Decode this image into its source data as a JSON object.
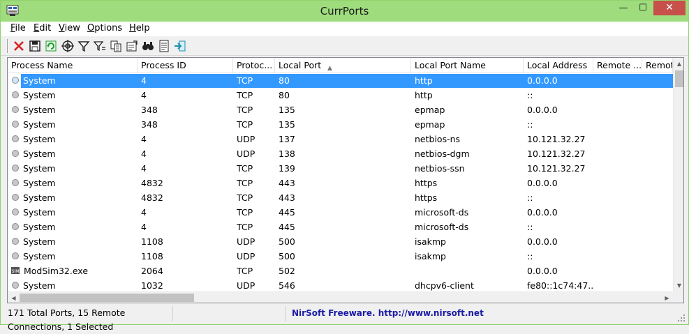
{
  "window": {
    "title": "CurrPorts",
    "minimize_glyph": "—",
    "maximize_glyph": "☐",
    "close_glyph": "✕"
  },
  "menu": [
    {
      "label": "File",
      "u": "F",
      "rest": "ile"
    },
    {
      "label": "Edit",
      "u": "E",
      "rest": "dit"
    },
    {
      "label": "View",
      "u": "V",
      "rest": "iew"
    },
    {
      "label": "Options",
      "u": "O",
      "rest": "ptions"
    },
    {
      "label": "Help",
      "u": "H",
      "rest": "elp"
    }
  ],
  "toolbar": [
    {
      "name": "close-connections-icon",
      "color": "#d42020"
    },
    {
      "name": "save-icon",
      "color": "#222222"
    },
    {
      "name": "refresh-icon",
      "color": "#1f9b2e"
    },
    {
      "name": "target-icon",
      "color": "#222222"
    },
    {
      "name": "filter-icon",
      "color": "#222222"
    },
    {
      "name": "filter-advanced-icon",
      "color": "#222222"
    },
    {
      "name": "copy-icon",
      "color": "#222222"
    },
    {
      "name": "properties-icon",
      "color": "#222222"
    },
    {
      "name": "find-icon",
      "color": "#222222"
    },
    {
      "name": "html-report-icon",
      "color": "#222222"
    },
    {
      "name": "exit-icon",
      "color": "#1b8fb0"
    }
  ],
  "columns": [
    "Process Name",
    "Process ID",
    "Protoc...",
    "Local Port",
    "Local Port Name",
    "Local Address",
    "Remote ...",
    "Remot"
  ],
  "sort_indicator": "▲",
  "rows": [
    {
      "process": "System",
      "pid": "4",
      "protocol": "TCP",
      "local_port": "80",
      "port_name": "http",
      "local_address": "0.0.0.0",
      "selected": true,
      "icon": "system"
    },
    {
      "process": "System",
      "pid": "4",
      "protocol": "TCP",
      "local_port": "80",
      "port_name": "http",
      "local_address": "::",
      "selected": false,
      "icon": "system"
    },
    {
      "process": "System",
      "pid": "348",
      "protocol": "TCP",
      "local_port": "135",
      "port_name": "epmap",
      "local_address": "0.0.0.0",
      "selected": false,
      "icon": "system"
    },
    {
      "process": "System",
      "pid": "348",
      "protocol": "TCP",
      "local_port": "135",
      "port_name": "epmap",
      "local_address": "::",
      "selected": false,
      "icon": "system"
    },
    {
      "process": "System",
      "pid": "4",
      "protocol": "UDP",
      "local_port": "137",
      "port_name": "netbios-ns",
      "local_address": "10.121.32.27",
      "selected": false,
      "icon": "system"
    },
    {
      "process": "System",
      "pid": "4",
      "protocol": "UDP",
      "local_port": "138",
      "port_name": "netbios-dgm",
      "local_address": "10.121.32.27",
      "selected": false,
      "icon": "system"
    },
    {
      "process": "System",
      "pid": "4",
      "protocol": "TCP",
      "local_port": "139",
      "port_name": "netbios-ssn",
      "local_address": "10.121.32.27",
      "selected": false,
      "icon": "system"
    },
    {
      "process": "System",
      "pid": "4832",
      "protocol": "TCP",
      "local_port": "443",
      "port_name": "https",
      "local_address": "0.0.0.0",
      "selected": false,
      "icon": "system"
    },
    {
      "process": "System",
      "pid": "4832",
      "protocol": "TCP",
      "local_port": "443",
      "port_name": "https",
      "local_address": "::",
      "selected": false,
      "icon": "system"
    },
    {
      "process": "System",
      "pid": "4",
      "protocol": "TCP",
      "local_port": "445",
      "port_name": "microsoft-ds",
      "local_address": "0.0.0.0",
      "selected": false,
      "icon": "system"
    },
    {
      "process": "System",
      "pid": "4",
      "protocol": "TCP",
      "local_port": "445",
      "port_name": "microsoft-ds",
      "local_address": "::",
      "selected": false,
      "icon": "system"
    },
    {
      "process": "System",
      "pid": "1108",
      "protocol": "UDP",
      "local_port": "500",
      "port_name": "isakmp",
      "local_address": "0.0.0.0",
      "selected": false,
      "icon": "system"
    },
    {
      "process": "System",
      "pid": "1108",
      "protocol": "UDP",
      "local_port": "500",
      "port_name": "isakmp",
      "local_address": "::",
      "selected": false,
      "icon": "system"
    },
    {
      "process": "ModSim32.exe",
      "pid": "2064",
      "protocol": "TCP",
      "local_port": "502",
      "port_name": "",
      "local_address": "0.0.0.0",
      "selected": false,
      "icon": "sim",
      "icon_text": "SIM"
    },
    {
      "process": "System",
      "pid": "1032",
      "protocol": "UDP",
      "local_port": "546",
      "port_name": "dhcpv6-client",
      "local_address": "fe80::1c74:47...",
      "selected": false,
      "icon": "system"
    }
  ],
  "scroll": {
    "up": "▲",
    "down": "▼",
    "left": "◀",
    "right": "▶"
  },
  "status": {
    "summary": "171 Total Ports, 15 Remote Connections, 1 Selected",
    "link": "NirSoft Freeware.  http://www.nirsoft.net"
  },
  "colors": {
    "titlebar": "#9fdc7d",
    "selection": "#3399ff",
    "close": "#c7504a",
    "link": "#1a1aa6"
  }
}
